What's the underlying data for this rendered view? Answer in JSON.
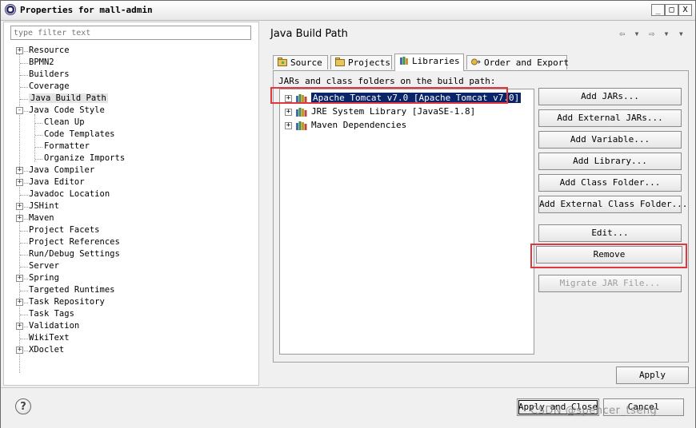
{
  "window": {
    "title": "Properties for mall-admin",
    "minimize": "_",
    "maximize": "□",
    "close": "X"
  },
  "filter": {
    "placeholder": "type filter text"
  },
  "tree": {
    "items": [
      {
        "label": "Resource",
        "toggle": "+"
      },
      {
        "label": "BPMN2",
        "toggle": ""
      },
      {
        "label": "Builders",
        "toggle": ""
      },
      {
        "label": "Coverage",
        "toggle": ""
      },
      {
        "label": "Java Build Path",
        "toggle": ""
      },
      {
        "label": "Java Code Style",
        "toggle": "-"
      },
      {
        "label": "Clean Up",
        "toggle": ""
      },
      {
        "label": "Code Templates",
        "toggle": ""
      },
      {
        "label": "Formatter",
        "toggle": ""
      },
      {
        "label": "Organize Imports",
        "toggle": ""
      },
      {
        "label": "Java Compiler",
        "toggle": "+"
      },
      {
        "label": "Java Editor",
        "toggle": "+"
      },
      {
        "label": "Javadoc Location",
        "toggle": ""
      },
      {
        "label": "JSHint",
        "toggle": "+"
      },
      {
        "label": "Maven",
        "toggle": "+"
      },
      {
        "label": "Project Facets",
        "toggle": ""
      },
      {
        "label": "Project References",
        "toggle": ""
      },
      {
        "label": "Run/Debug Settings",
        "toggle": ""
      },
      {
        "label": "Server",
        "toggle": ""
      },
      {
        "label": "Spring",
        "toggle": "+"
      },
      {
        "label": "Targeted Runtimes",
        "toggle": ""
      },
      {
        "label": "Task Repository",
        "toggle": "+"
      },
      {
        "label": "Task Tags",
        "toggle": ""
      },
      {
        "label": "Validation",
        "toggle": "+"
      },
      {
        "label": "WikiText",
        "toggle": ""
      },
      {
        "label": "XDoclet",
        "toggle": "+"
      }
    ]
  },
  "page": {
    "title": "Java Build Path",
    "nav": "⇦ ▾ ⇨ ▾ ▾"
  },
  "tabs": [
    {
      "label": "Source"
    },
    {
      "label": "Projects"
    },
    {
      "label": "Libraries"
    },
    {
      "label": "Order and Export"
    }
  ],
  "libraries": {
    "caption": "JARs and class folders on the build path:",
    "items": [
      {
        "label": "Apache Tomcat v7.0 [Apache Tomcat v7.0]",
        "toggle": "+"
      },
      {
        "label": "JRE System Library [JavaSE-1.8]",
        "toggle": "+"
      },
      {
        "label": "Maven Dependencies",
        "toggle": "+"
      }
    ]
  },
  "buttons": {
    "add_jars": "Add JARs...",
    "add_external_jars": "Add External JARs...",
    "add_variable": "Add Variable...",
    "add_library": "Add Library...",
    "add_class_folder": "Add Class Folder...",
    "add_external_class_folder": "Add External Class Folder...",
    "edit": "Edit...",
    "remove": "Remove",
    "migrate_jar": "Migrate JAR File...",
    "apply": "Apply",
    "apply_close": "Apply and Close",
    "cancel": "Cancel",
    "help": "?"
  },
  "watermark": "CSDN @spencer_tseng",
  "colors": {
    "selection": "#0a246a",
    "highlight_box": "#e0383e"
  }
}
